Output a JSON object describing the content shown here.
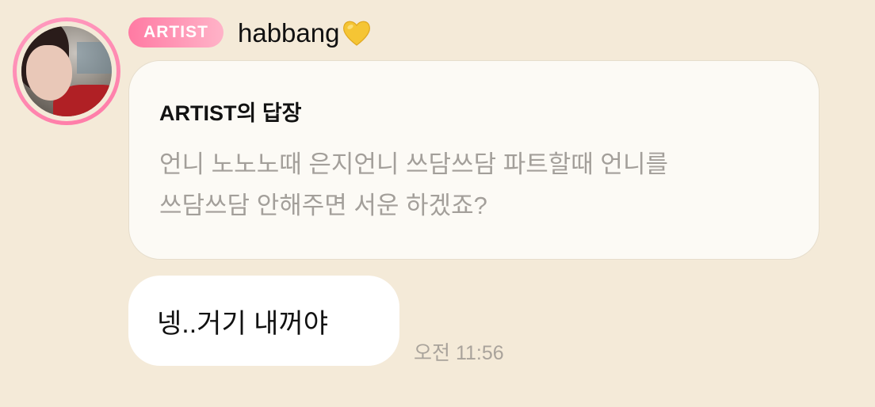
{
  "post": {
    "badge": "ARTIST",
    "username": "habbang",
    "reaction_icon": "yellow-heart-icon"
  },
  "reply": {
    "heading": "ARTIST의 답장",
    "quote_line1": "언니 노노노때 은지언니 쓰담쓰담 파트할때 언니를",
    "quote_line2": "쓰담쓰담 안해주면 서운 하겠죠?"
  },
  "message": {
    "text": "넹..거기 내꺼야",
    "time": "오전 11:56"
  },
  "colors": {
    "background": "#f4ead8",
    "badge_gradient_start": "#ff7aa3",
    "badge_gradient_end": "#ffb3c8",
    "avatar_ring": "#ff8fb3",
    "heart": "#f5c534"
  }
}
